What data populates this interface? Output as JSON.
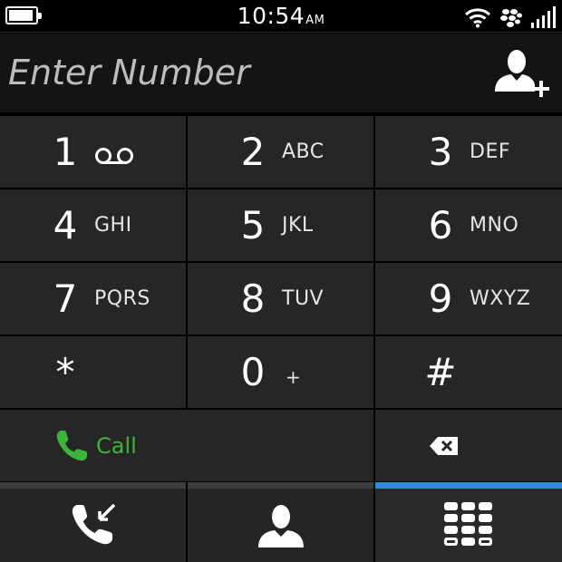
{
  "status_bar": {
    "time": "10:54",
    "ampm": "AM",
    "battery_level": 0.8,
    "icons": [
      "battery-icon",
      "wifi-icon",
      "blackberry-icon",
      "signal-icon"
    ]
  },
  "number_field": {
    "placeholder": "Enter Number",
    "add_contact_icon": "add-contact-icon"
  },
  "keypad": {
    "keys": [
      {
        "digit": "1",
        "letters": "",
        "icon": "voicemail-icon"
      },
      {
        "digit": "2",
        "letters": "ABC"
      },
      {
        "digit": "3",
        "letters": "DEF"
      },
      {
        "digit": "4",
        "letters": "GHI"
      },
      {
        "digit": "5",
        "letters": "JKL"
      },
      {
        "digit": "6",
        "letters": "MNO"
      },
      {
        "digit": "7",
        "letters": "PQRS"
      },
      {
        "digit": "8",
        "letters": "TUV"
      },
      {
        "digit": "9",
        "letters": "WXYZ"
      },
      {
        "digit": "*",
        "letters": ""
      },
      {
        "digit": "0",
        "letters": "+"
      },
      {
        "digit": "#",
        "letters": ""
      }
    ],
    "call_label": "Call",
    "call_icon": "phone-icon",
    "backspace_icon": "backspace-icon"
  },
  "bottom_nav": {
    "tabs": [
      {
        "name": "call-log",
        "icon": "call-log-icon",
        "active": false
      },
      {
        "name": "contacts",
        "icon": "contact-icon",
        "active": false
      },
      {
        "name": "dialpad",
        "icon": "dialpad-icon",
        "active": true
      }
    ],
    "accent_color": "#2b8fd6"
  },
  "colors": {
    "call_green": "#3cb43c",
    "key_bg": "#262626"
  }
}
